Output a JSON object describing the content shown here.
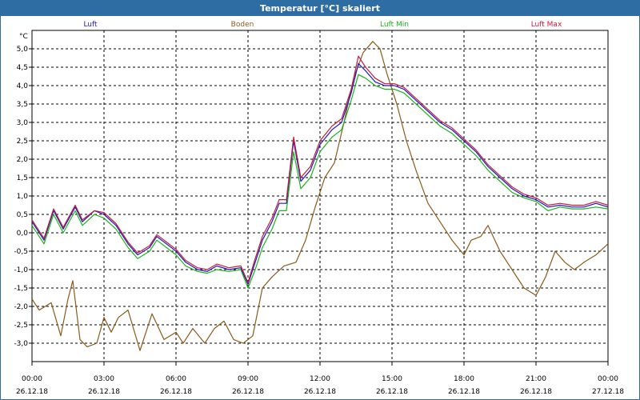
{
  "window": {
    "title": "Temperatur [°C] skaliert"
  },
  "chart_data": {
    "type": "line",
    "ylabel": "°C",
    "ylim": [
      -3.5,
      5.5
    ],
    "yticks": [
      -3.0,
      -2.5,
      -2.0,
      -1.5,
      -1.0,
      -0.5,
      0.0,
      0.5,
      1.0,
      1.5,
      2.0,
      2.5,
      3.0,
      3.5,
      4.0,
      4.5,
      5.0
    ],
    "ytick_labels": [
      "-3,0",
      "-2,5",
      "-2,0",
      "-1,5",
      "-1,0",
      "-0,5",
      "0,0",
      "0,5",
      "1,0",
      "1,5",
      "2,0",
      "2,5",
      "3,0",
      "3,5",
      "4,0",
      "4,5",
      "5,0"
    ],
    "xlim": [
      0,
      24
    ],
    "xticks": [
      0,
      3,
      6,
      9,
      12,
      15,
      18,
      21,
      24
    ],
    "xtick_times": [
      "00:00",
      "03:00",
      "06:00",
      "09:00",
      "12:00",
      "15:00",
      "18:00",
      "21:00",
      "00:00"
    ],
    "xtick_dates": [
      "26.12.18",
      "26.12.18",
      "26.12.18",
      "26.12.18",
      "26.12.18",
      "26.12.18",
      "26.12.18",
      "26.12.18",
      "27.12.18"
    ],
    "grid": true,
    "legend_position": "top",
    "series": [
      {
        "name": "Luft",
        "color": "#1a1ab4",
        "points": [
          [
            0,
            0.3
          ],
          [
            0.5,
            -0.2
          ],
          [
            0.9,
            0.6
          ],
          [
            1.3,
            0.1
          ],
          [
            1.8,
            0.7
          ],
          [
            2.1,
            0.3
          ],
          [
            2.6,
            0.6
          ],
          [
            3.0,
            0.5
          ],
          [
            3.5,
            0.2
          ],
          [
            4.0,
            -0.3
          ],
          [
            4.4,
            -0.6
          ],
          [
            4.9,
            -0.4
          ],
          [
            5.2,
            -0.1
          ],
          [
            5.6,
            -0.3
          ],
          [
            6.0,
            -0.5
          ],
          [
            6.4,
            -0.8
          ],
          [
            6.9,
            -1.0
          ],
          [
            7.3,
            -1.05
          ],
          [
            7.7,
            -0.9
          ],
          [
            8.2,
            -1.0
          ],
          [
            8.7,
            -0.95
          ],
          [
            9.0,
            -1.4
          ],
          [
            9.3,
            -0.8
          ],
          [
            9.6,
            -0.2
          ],
          [
            10.0,
            0.3
          ],
          [
            10.3,
            0.8
          ],
          [
            10.6,
            0.8
          ],
          [
            10.9,
            2.5
          ],
          [
            11.2,
            1.4
          ],
          [
            11.6,
            1.7
          ],
          [
            12.0,
            2.4
          ],
          [
            12.5,
            2.8
          ],
          [
            12.9,
            3.0
          ],
          [
            13.3,
            3.8
          ],
          [
            13.6,
            4.6
          ],
          [
            13.9,
            4.4
          ],
          [
            14.3,
            4.1
          ],
          [
            14.7,
            4.0
          ],
          [
            15.1,
            4.0
          ],
          [
            15.5,
            3.9
          ],
          [
            16.0,
            3.6
          ],
          [
            16.5,
            3.3
          ],
          [
            17.0,
            3.0
          ],
          [
            17.5,
            2.8
          ],
          [
            18.0,
            2.5
          ],
          [
            18.5,
            2.2
          ],
          [
            19.0,
            1.8
          ],
          [
            19.5,
            1.5
          ],
          [
            20.0,
            1.2
          ],
          [
            20.5,
            1.0
          ],
          [
            21.0,
            0.9
          ],
          [
            21.5,
            0.7
          ],
          [
            22.0,
            0.75
          ],
          [
            22.5,
            0.7
          ],
          [
            23.0,
            0.7
          ],
          [
            23.5,
            0.8
          ],
          [
            24.0,
            0.7
          ]
        ]
      },
      {
        "name": "Boden",
        "color": "#8a5a1a",
        "points": [
          [
            0,
            -1.8
          ],
          [
            0.3,
            -2.1
          ],
          [
            0.8,
            -1.9
          ],
          [
            1.2,
            -2.8
          ],
          [
            1.5,
            -1.8
          ],
          [
            1.7,
            -1.3
          ],
          [
            2.0,
            -2.9
          ],
          [
            2.3,
            -3.1
          ],
          [
            2.7,
            -3.0
          ],
          [
            3.0,
            -2.3
          ],
          [
            3.3,
            -2.7
          ],
          [
            3.6,
            -2.3
          ],
          [
            4.0,
            -2.1
          ],
          [
            4.5,
            -3.2
          ],
          [
            5.0,
            -2.2
          ],
          [
            5.5,
            -2.9
          ],
          [
            6.0,
            -2.7
          ],
          [
            6.3,
            -3.0
          ],
          [
            6.7,
            -2.6
          ],
          [
            7.2,
            -3.0
          ],
          [
            7.6,
            -2.6
          ],
          [
            8.0,
            -2.4
          ],
          [
            8.4,
            -2.9
          ],
          [
            8.8,
            -3.0
          ],
          [
            9.2,
            -2.8
          ],
          [
            9.6,
            -1.5
          ],
          [
            10.0,
            -1.2
          ],
          [
            10.5,
            -0.9
          ],
          [
            11.0,
            -0.8
          ],
          [
            11.4,
            -0.2
          ],
          [
            11.8,
            0.7
          ],
          [
            12.2,
            1.5
          ],
          [
            12.6,
            1.9
          ],
          [
            13.0,
            3.0
          ],
          [
            13.4,
            4.2
          ],
          [
            13.8,
            4.9
          ],
          [
            14.2,
            5.2
          ],
          [
            14.5,
            5.0
          ],
          [
            14.8,
            4.3
          ],
          [
            15.2,
            3.5
          ],
          [
            15.6,
            2.5
          ],
          [
            16.0,
            1.7
          ],
          [
            16.5,
            0.8
          ],
          [
            17.0,
            0.3
          ],
          [
            17.5,
            -0.2
          ],
          [
            18.0,
            -0.6
          ],
          [
            18.3,
            -0.2
          ],
          [
            18.7,
            -0.1
          ],
          [
            19.0,
            0.2
          ],
          [
            19.5,
            -0.5
          ],
          [
            20.0,
            -1.0
          ],
          [
            20.5,
            -1.5
          ],
          [
            21.0,
            -1.7
          ],
          [
            21.4,
            -1.2
          ],
          [
            21.8,
            -0.5
          ],
          [
            22.2,
            -0.8
          ],
          [
            22.6,
            -1.0
          ],
          [
            23.0,
            -0.8
          ],
          [
            23.5,
            -0.6
          ],
          [
            24.0,
            -0.3
          ]
        ]
      },
      {
        "name": "Luft Min",
        "color": "#1ab41a",
        "points": [
          [
            0,
            0.2
          ],
          [
            0.5,
            -0.3
          ],
          [
            0.9,
            0.5
          ],
          [
            1.3,
            0.0
          ],
          [
            1.8,
            0.6
          ],
          [
            2.1,
            0.2
          ],
          [
            2.6,
            0.5
          ],
          [
            3.0,
            0.4
          ],
          [
            3.5,
            0.1
          ],
          [
            4.0,
            -0.4
          ],
          [
            4.4,
            -0.7
          ],
          [
            4.9,
            -0.5
          ],
          [
            5.2,
            -0.2
          ],
          [
            5.6,
            -0.4
          ],
          [
            6.0,
            -0.6
          ],
          [
            6.4,
            -0.9
          ],
          [
            6.9,
            -1.05
          ],
          [
            7.3,
            -1.1
          ],
          [
            7.7,
            -1.0
          ],
          [
            8.2,
            -1.05
          ],
          [
            8.7,
            -1.0
          ],
          [
            9.0,
            -1.5
          ],
          [
            9.3,
            -1.0
          ],
          [
            9.6,
            -0.4
          ],
          [
            10.0,
            0.1
          ],
          [
            10.3,
            0.6
          ],
          [
            10.6,
            0.6
          ],
          [
            10.9,
            2.2
          ],
          [
            11.2,
            1.2
          ],
          [
            11.6,
            1.5
          ],
          [
            12.0,
            2.2
          ],
          [
            12.5,
            2.6
          ],
          [
            12.9,
            2.8
          ],
          [
            13.3,
            3.6
          ],
          [
            13.6,
            4.3
          ],
          [
            13.9,
            4.2
          ],
          [
            14.3,
            4.0
          ],
          [
            14.7,
            3.9
          ],
          [
            15.1,
            3.9
          ],
          [
            15.5,
            3.8
          ],
          [
            16.0,
            3.5
          ],
          [
            16.5,
            3.2
          ],
          [
            17.0,
            2.9
          ],
          [
            17.5,
            2.7
          ],
          [
            18.0,
            2.4
          ],
          [
            18.5,
            2.1
          ],
          [
            19.0,
            1.7
          ],
          [
            19.5,
            1.4
          ],
          [
            20.0,
            1.1
          ],
          [
            20.5,
            0.95
          ],
          [
            21.0,
            0.85
          ],
          [
            21.5,
            0.6
          ],
          [
            22.0,
            0.7
          ],
          [
            22.5,
            0.65
          ],
          [
            23.0,
            0.65
          ],
          [
            23.5,
            0.7
          ],
          [
            24.0,
            0.65
          ]
        ]
      },
      {
        "name": "Luft Max",
        "color": "#c81a3c",
        "points": [
          [
            0,
            0.35
          ],
          [
            0.5,
            -0.15
          ],
          [
            0.9,
            0.65
          ],
          [
            1.3,
            0.15
          ],
          [
            1.8,
            0.75
          ],
          [
            2.1,
            0.35
          ],
          [
            2.6,
            0.6
          ],
          [
            3.0,
            0.55
          ],
          [
            3.5,
            0.25
          ],
          [
            4.0,
            -0.25
          ],
          [
            4.4,
            -0.55
          ],
          [
            4.9,
            -0.35
          ],
          [
            5.2,
            -0.05
          ],
          [
            5.6,
            -0.25
          ],
          [
            6.0,
            -0.45
          ],
          [
            6.4,
            -0.75
          ],
          [
            6.9,
            -0.95
          ],
          [
            7.3,
            -1.0
          ],
          [
            7.7,
            -0.85
          ],
          [
            8.2,
            -0.95
          ],
          [
            8.7,
            -0.9
          ],
          [
            9.0,
            -1.35
          ],
          [
            9.3,
            -0.7
          ],
          [
            9.6,
            -0.1
          ],
          [
            10.0,
            0.4
          ],
          [
            10.3,
            0.9
          ],
          [
            10.6,
            0.9
          ],
          [
            10.9,
            2.6
          ],
          [
            11.2,
            1.5
          ],
          [
            11.6,
            1.8
          ],
          [
            12.0,
            2.5
          ],
          [
            12.5,
            2.9
          ],
          [
            12.9,
            3.1
          ],
          [
            13.3,
            3.9
          ],
          [
            13.6,
            4.8
          ],
          [
            13.9,
            4.5
          ],
          [
            14.3,
            4.2
          ],
          [
            14.7,
            4.05
          ],
          [
            15.1,
            4.05
          ],
          [
            15.5,
            3.95
          ],
          [
            16.0,
            3.65
          ],
          [
            16.5,
            3.35
          ],
          [
            17.0,
            3.05
          ],
          [
            17.5,
            2.85
          ],
          [
            18.0,
            2.55
          ],
          [
            18.5,
            2.25
          ],
          [
            19.0,
            1.85
          ],
          [
            19.5,
            1.55
          ],
          [
            20.0,
            1.25
          ],
          [
            20.5,
            1.05
          ],
          [
            21.0,
            0.95
          ],
          [
            21.5,
            0.75
          ],
          [
            22.0,
            0.8
          ],
          [
            22.5,
            0.75
          ],
          [
            23.0,
            0.75
          ],
          [
            23.5,
            0.85
          ],
          [
            24.0,
            0.75
          ]
        ]
      }
    ]
  }
}
